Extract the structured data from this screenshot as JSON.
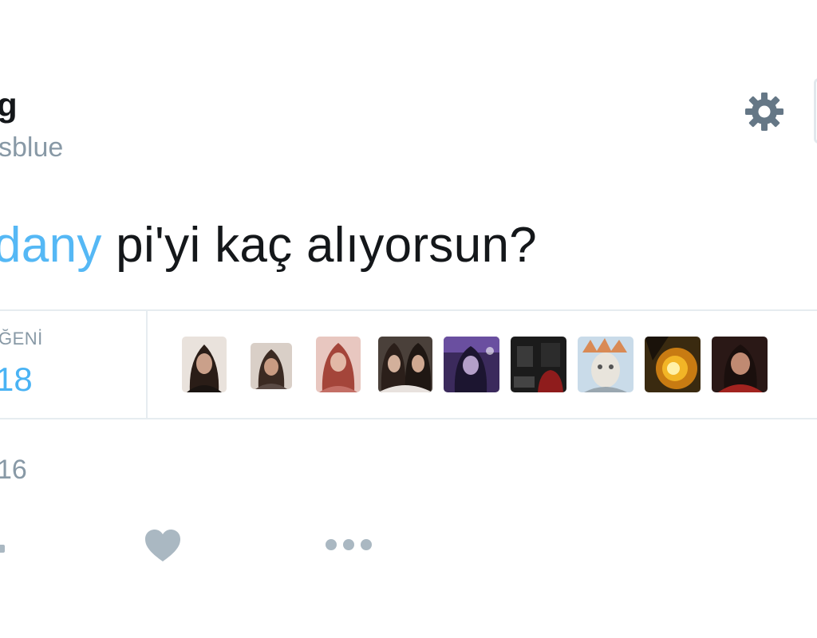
{
  "tweet": {
    "display_name": "g",
    "handle": "sblue",
    "text": {
      "mention": "dany",
      "body": " pi'yi kaç alıyorsun?"
    },
    "stats": {
      "likes_label": "ĞENİ",
      "likes_count": "18"
    },
    "liker_avatars": [
      "liker-avatar-1",
      "liker-avatar-2",
      "liker-avatar-3",
      "liker-avatar-4",
      "liker-avatar-5",
      "liker-avatar-6",
      "liker-avatar-7",
      "liker-avatar-8",
      "liker-avatar-9"
    ],
    "timestamp": "16"
  },
  "icons": {
    "settings": "gear-icon",
    "like": "heart-icon",
    "more": "more-dots-icon",
    "reply": "reply-icon"
  },
  "colors": {
    "mention": "#1da1f2",
    "muted": "#8899a6",
    "icon": "#657786",
    "action_icon": "#aab8c2",
    "divider": "#e6ecf0"
  }
}
